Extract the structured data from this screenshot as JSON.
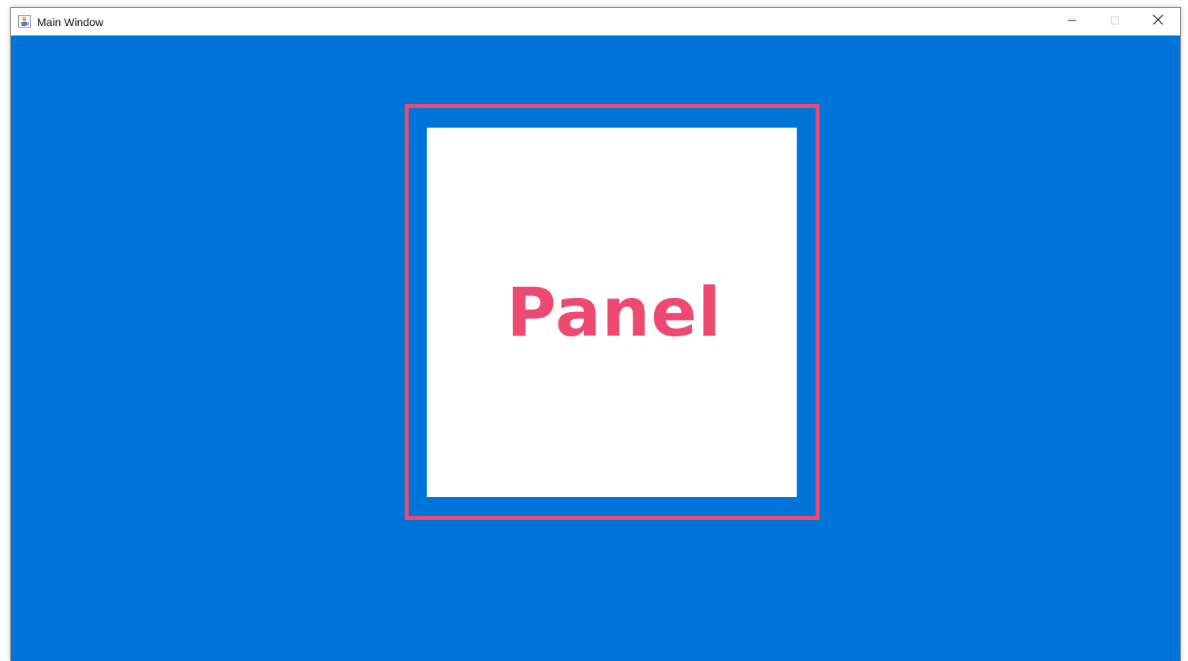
{
  "window": {
    "title": "Main Window",
    "icon": "java-cup-icon",
    "controls": {
      "minimize_icon": "minimize-icon",
      "maximize_icon": "maximize-icon",
      "close_icon": "close-icon"
    }
  },
  "panel": {
    "label": "Panel"
  },
  "colors": {
    "background": "#0075d9",
    "frame": "#ee4970",
    "panel": "#ffffff",
    "label": "#ee4970"
  }
}
